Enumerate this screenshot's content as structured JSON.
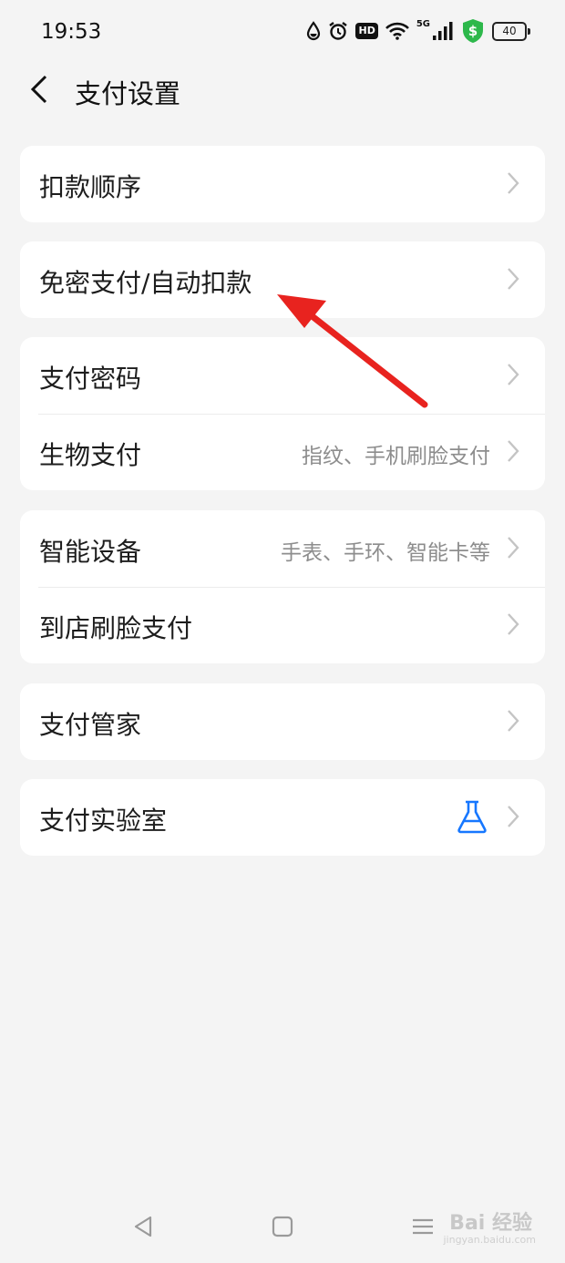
{
  "status_bar": {
    "time": "19:53",
    "hd": "HD",
    "network": "5G",
    "battery": "40",
    "shield_color": "#2db84b"
  },
  "header": {
    "title": "支付设置"
  },
  "groups": [
    {
      "rows": [
        {
          "label": "扣款顺序"
        }
      ]
    },
    {
      "rows": [
        {
          "label": "免密支付/自动扣款"
        }
      ]
    },
    {
      "rows": [
        {
          "label": "支付密码"
        },
        {
          "label": "生物支付",
          "value": "指纹、手机刷脸支付"
        }
      ]
    },
    {
      "rows": [
        {
          "label": "智能设备",
          "value": "手表、手环、智能卡等"
        },
        {
          "label": "到店刷脸支付"
        }
      ]
    },
    {
      "rows": [
        {
          "label": "支付管家"
        }
      ]
    },
    {
      "rows": [
        {
          "label": "支付实验室",
          "icon": "flask-icon"
        }
      ]
    }
  ],
  "annotation": {
    "color": "#e8231f"
  },
  "watermark": {
    "text": "Bai 经验",
    "sub": "jingyan.baidu.com"
  },
  "colors": {
    "background": "#f4f4f4",
    "card": "#ffffff",
    "accent_blue": "#1677ff"
  }
}
